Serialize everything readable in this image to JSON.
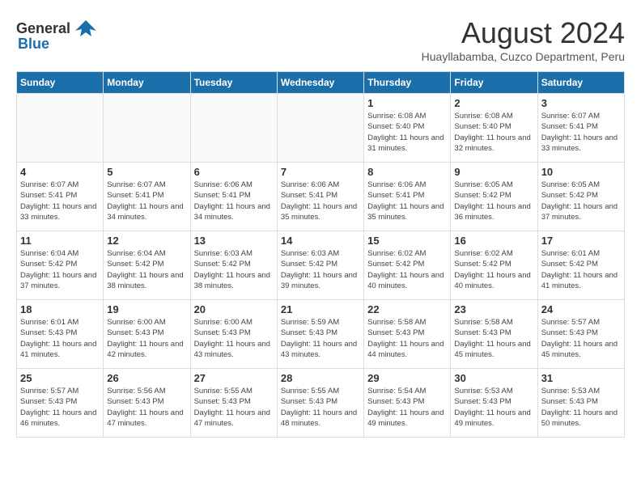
{
  "header": {
    "logo_general": "General",
    "logo_blue": "Blue",
    "month_title": "August 2024",
    "location": "Huayllabamba, Cuzco Department, Peru"
  },
  "weekdays": [
    "Sunday",
    "Monday",
    "Tuesday",
    "Wednesday",
    "Thursday",
    "Friday",
    "Saturday"
  ],
  "weeks": [
    [
      {
        "day": "",
        "info": ""
      },
      {
        "day": "",
        "info": ""
      },
      {
        "day": "",
        "info": ""
      },
      {
        "day": "",
        "info": ""
      },
      {
        "day": "1",
        "info": "Sunrise: 6:08 AM\nSunset: 5:40 PM\nDaylight: 11 hours and 31 minutes."
      },
      {
        "day": "2",
        "info": "Sunrise: 6:08 AM\nSunset: 5:40 PM\nDaylight: 11 hours and 32 minutes."
      },
      {
        "day": "3",
        "info": "Sunrise: 6:07 AM\nSunset: 5:41 PM\nDaylight: 11 hours and 33 minutes."
      }
    ],
    [
      {
        "day": "4",
        "info": "Sunrise: 6:07 AM\nSunset: 5:41 PM\nDaylight: 11 hours and 33 minutes."
      },
      {
        "day": "5",
        "info": "Sunrise: 6:07 AM\nSunset: 5:41 PM\nDaylight: 11 hours and 34 minutes."
      },
      {
        "day": "6",
        "info": "Sunrise: 6:06 AM\nSunset: 5:41 PM\nDaylight: 11 hours and 34 minutes."
      },
      {
        "day": "7",
        "info": "Sunrise: 6:06 AM\nSunset: 5:41 PM\nDaylight: 11 hours and 35 minutes."
      },
      {
        "day": "8",
        "info": "Sunrise: 6:06 AM\nSunset: 5:41 PM\nDaylight: 11 hours and 35 minutes."
      },
      {
        "day": "9",
        "info": "Sunrise: 6:05 AM\nSunset: 5:42 PM\nDaylight: 11 hours and 36 minutes."
      },
      {
        "day": "10",
        "info": "Sunrise: 6:05 AM\nSunset: 5:42 PM\nDaylight: 11 hours and 37 minutes."
      }
    ],
    [
      {
        "day": "11",
        "info": "Sunrise: 6:04 AM\nSunset: 5:42 PM\nDaylight: 11 hours and 37 minutes."
      },
      {
        "day": "12",
        "info": "Sunrise: 6:04 AM\nSunset: 5:42 PM\nDaylight: 11 hours and 38 minutes."
      },
      {
        "day": "13",
        "info": "Sunrise: 6:03 AM\nSunset: 5:42 PM\nDaylight: 11 hours and 38 minutes."
      },
      {
        "day": "14",
        "info": "Sunrise: 6:03 AM\nSunset: 5:42 PM\nDaylight: 11 hours and 39 minutes."
      },
      {
        "day": "15",
        "info": "Sunrise: 6:02 AM\nSunset: 5:42 PM\nDaylight: 11 hours and 40 minutes."
      },
      {
        "day": "16",
        "info": "Sunrise: 6:02 AM\nSunset: 5:42 PM\nDaylight: 11 hours and 40 minutes."
      },
      {
        "day": "17",
        "info": "Sunrise: 6:01 AM\nSunset: 5:42 PM\nDaylight: 11 hours and 41 minutes."
      }
    ],
    [
      {
        "day": "18",
        "info": "Sunrise: 6:01 AM\nSunset: 5:43 PM\nDaylight: 11 hours and 41 minutes."
      },
      {
        "day": "19",
        "info": "Sunrise: 6:00 AM\nSunset: 5:43 PM\nDaylight: 11 hours and 42 minutes."
      },
      {
        "day": "20",
        "info": "Sunrise: 6:00 AM\nSunset: 5:43 PM\nDaylight: 11 hours and 43 minutes."
      },
      {
        "day": "21",
        "info": "Sunrise: 5:59 AM\nSunset: 5:43 PM\nDaylight: 11 hours and 43 minutes."
      },
      {
        "day": "22",
        "info": "Sunrise: 5:58 AM\nSunset: 5:43 PM\nDaylight: 11 hours and 44 minutes."
      },
      {
        "day": "23",
        "info": "Sunrise: 5:58 AM\nSunset: 5:43 PM\nDaylight: 11 hours and 45 minutes."
      },
      {
        "day": "24",
        "info": "Sunrise: 5:57 AM\nSunset: 5:43 PM\nDaylight: 11 hours and 45 minutes."
      }
    ],
    [
      {
        "day": "25",
        "info": "Sunrise: 5:57 AM\nSunset: 5:43 PM\nDaylight: 11 hours and 46 minutes."
      },
      {
        "day": "26",
        "info": "Sunrise: 5:56 AM\nSunset: 5:43 PM\nDaylight: 11 hours and 47 minutes."
      },
      {
        "day": "27",
        "info": "Sunrise: 5:55 AM\nSunset: 5:43 PM\nDaylight: 11 hours and 47 minutes."
      },
      {
        "day": "28",
        "info": "Sunrise: 5:55 AM\nSunset: 5:43 PM\nDaylight: 11 hours and 48 minutes."
      },
      {
        "day": "29",
        "info": "Sunrise: 5:54 AM\nSunset: 5:43 PM\nDaylight: 11 hours and 49 minutes."
      },
      {
        "day": "30",
        "info": "Sunrise: 5:53 AM\nSunset: 5:43 PM\nDaylight: 11 hours and 49 minutes."
      },
      {
        "day": "31",
        "info": "Sunrise: 5:53 AM\nSunset: 5:43 PM\nDaylight: 11 hours and 50 minutes."
      }
    ]
  ]
}
